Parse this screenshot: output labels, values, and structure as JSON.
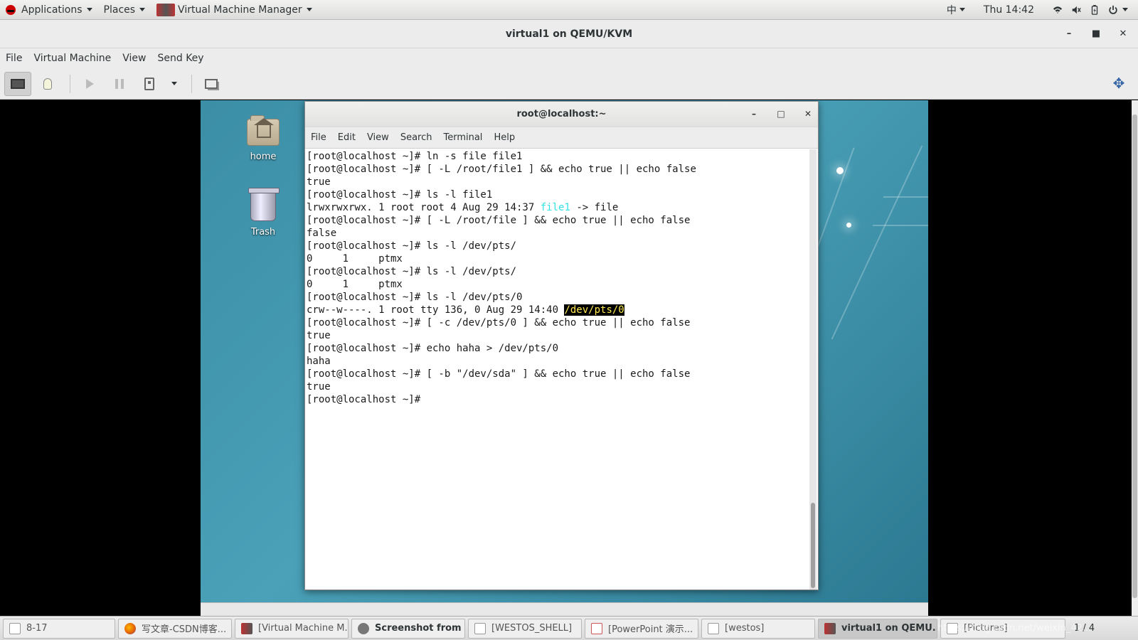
{
  "topbar": {
    "applications": "Applications",
    "places": "Places",
    "active_app": "Virtual Machine Manager",
    "input_method": "中",
    "clock": "Thu 14:42"
  },
  "window": {
    "title": "virtual1 on QEMU/KVM",
    "menu": [
      "File",
      "Virtual Machine",
      "View",
      "Send Key"
    ]
  },
  "guest": {
    "desktop_icons": [
      {
        "label": "home",
        "icon": "home-folder-icon"
      },
      {
        "label": "Trash",
        "icon": "trash-icon"
      }
    ],
    "terminal": {
      "title": "root@localhost:~",
      "menu": [
        "File",
        "Edit",
        "View",
        "Search",
        "Terminal",
        "Help"
      ],
      "lines": [
        "[root@localhost ~]# ln -s file file1",
        "[root@localhost ~]# [ -L /root/file1 ] && echo true || echo false",
        "true",
        "[root@localhost ~]# ls -l file1",
        "lrwxrwxrwx. 1 root root 4 Aug 29 14:37 ",
        "[root@localhost ~]# [ -L /root/file ] && echo true || echo false",
        "false",
        "[root@localhost ~]# ls -l /dev/pts/",
        "0     1     ptmx",
        "[root@localhost ~]# ls -l /dev/pts/",
        "0     1     ptmx",
        "[root@localhost ~]# ls -l /dev/pts/0",
        "crw--w----. 1 root tty 136, 0 Aug 29 14:40 ",
        "[root@localhost ~]# [ -c /dev/pts/0 ] && echo true || echo false",
        "true",
        "[root@localhost ~]# echo haha > /dev/pts/0",
        "haha",
        "[root@localhost ~]# [ -b \"/dev/sda\" ] && echo true || echo false",
        "true",
        "[root@localhost ~]# "
      ],
      "link_name": "file1",
      "link_target": " -> file",
      "device_name": "/dev/pts/0",
      "colors": {
        "link": "#34e2e2",
        "highlight_bg": "#000000",
        "highlight_fg": "#fce94f"
      }
    }
  },
  "taskbar": {
    "items": [
      {
        "label": "8-17",
        "icon": "workspace-icon"
      },
      {
        "label": "写文章-CSDN博客...",
        "icon": "firefox-icon"
      },
      {
        "label": "[Virtual Machine M...",
        "icon": "vmm-icon"
      },
      {
        "label": "Screenshot from 2...",
        "icon": "screenshot-icon"
      },
      {
        "label": "[WESTOS_SHELL]",
        "icon": "folder-icon"
      },
      {
        "label": "[PowerPoint 演示...",
        "icon": "presentation-icon"
      },
      {
        "label": "[westos]",
        "icon": "document-icon"
      },
      {
        "label": "virtual1 on QEMU...",
        "icon": "vmm-icon"
      },
      {
        "label": "[Pictures]",
        "icon": "folder-icon"
      }
    ],
    "pager": "1 / 4",
    "watermark": "https://blog.csdn.net/weixin_42..."
  }
}
